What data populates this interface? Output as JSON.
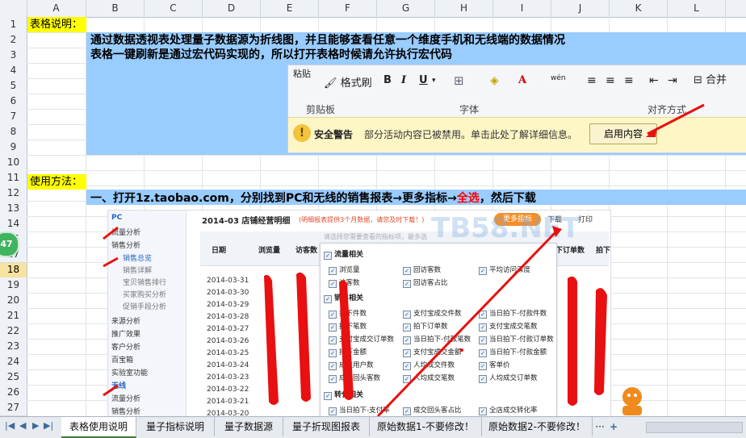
{
  "columns": [
    "A",
    "B",
    "C",
    "D",
    "E",
    "F",
    "G",
    "H",
    "I",
    "J",
    "K",
    "L"
  ],
  "rows": [
    "1",
    "2",
    "3",
    "4",
    "5",
    "6",
    "7",
    "8",
    "9",
    "10",
    "11",
    "12",
    "13",
    "14",
    "15",
    "16",
    "17",
    "18",
    "19",
    "20",
    "21",
    "22",
    "23",
    "24",
    "25",
    "26",
    "27"
  ],
  "selected_row": "18",
  "cells": {
    "a1": "表格说明：",
    "b2": "通过数据透视表处理量子数据源为折线图，并且能够查看任意一个维度手机和无线端的数据情况",
    "b3": "表格一键刷新是通过宏代码实现的，所以打开表格时候请允许执行宏代码",
    "a12": "使用方法：",
    "b13_part1": "一、打开1z.taobao.com，分别找到PC和无线的销售报表→更多指标→",
    "b13_red": "全选",
    "b13_part2": "，然后下载"
  },
  "ribbon": {
    "paste": "粘贴",
    "format_painter": "格式刷",
    "clipboard": "剪贴板",
    "font": "字体",
    "align": "对齐方式",
    "merge": "合并",
    "bold": "B",
    "italic": "I",
    "underline": "U",
    "font_color": "A",
    "phonetic": "wén",
    "security_title": "安全警告",
    "security_msg": "部分活动内容已被禁用。单击此处了解详细信息。",
    "enable_btn": "启用内容"
  },
  "shot": {
    "nav": [
      "PC",
      "流量分析",
      "销售分析",
      "销售总览",
      "销售详解",
      "宝贝销售排行",
      "买家购买分析",
      "促销手段分析",
      "来源分析",
      "推广效果",
      "客户分析",
      "百宝箱",
      "实验室功能",
      "无线",
      "流量分析",
      "销售分析"
    ],
    "title": "2014-03 店铺经营明细",
    "note": "(明细报表提供3个月数据，请您及时下载！)",
    "more": "更多指标",
    "download": "下载",
    "print": "打印",
    "cols": [
      "日期",
      "浏览量",
      "访客数",
      "下订单数",
      "拍下"
    ],
    "dates": [
      "2014-03-31",
      "2014-03-30",
      "2014-03-29",
      "2014-03-28",
      "2014-03-27",
      "2014-03-26",
      "2014-03-25",
      "2014-03-24",
      "2014-03-23",
      "2014-03-22",
      "2014-03-21",
      "2014-03-20"
    ],
    "hint": "请选择您需要查看的指标项，最多选",
    "groups": [
      "流量相关",
      "销售相关",
      "转化相关"
    ],
    "opts_traffic": [
      "浏览量",
      "回访客数",
      "平均访问深度",
      "访客数",
      "回访客占比"
    ],
    "opts_sales": [
      "拍下件数",
      "支付宝成交件数",
      "当日拍下-付款件数",
      "拍下笔数",
      "拍下订单数",
      "支付宝成交笔数",
      "支付宝成交订单数",
      "当日拍下-付款笔数",
      "当日拍下-付款订单数",
      "拍下金额",
      "支付宝成交金额",
      "当日拍下-付款金额",
      "成交用户数",
      "人均成交件数",
      "客单价",
      "成交回头客数",
      "人均成交笔数",
      "人均成交订单数"
    ],
    "opts_conv": [
      "当日拍下-支付率",
      "成交回头客占比",
      "全店成交转化率"
    ],
    "watermark": "TB58.NET"
  },
  "side_badge": "47",
  "tabs": [
    "表格使用说明",
    "量子指标说明",
    "量子数据源",
    "量子折现图报表",
    "原始数据1-不要修改！",
    "原始数据2-不要修改！"
  ],
  "active_tab": "表格使用说明",
  "tab_more": "···",
  "tab_add": "+"
}
